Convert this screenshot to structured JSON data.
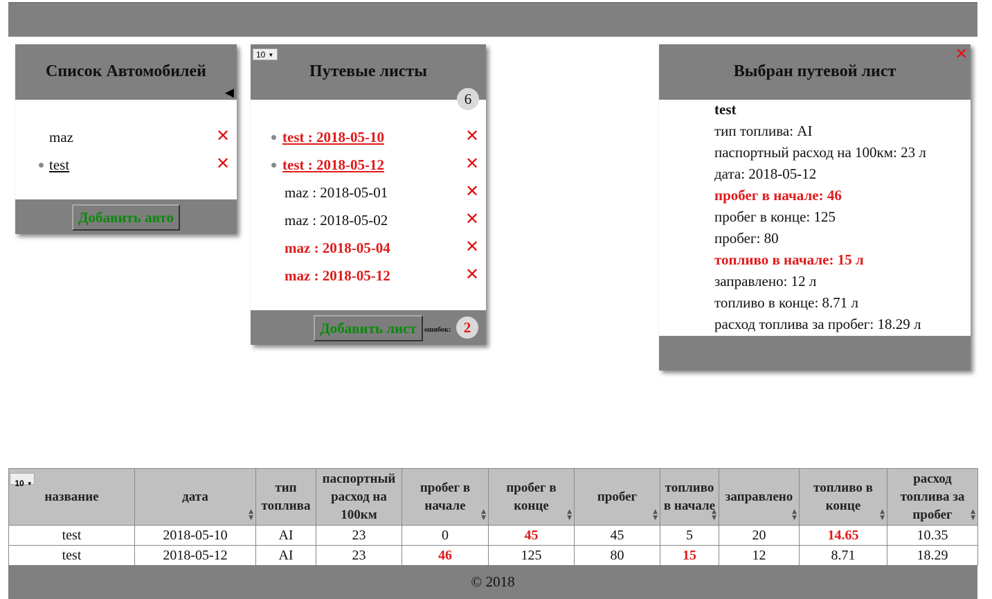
{
  "cars": {
    "title": "Список Автомобилей",
    "collapse_glyph": "◀",
    "items": [
      {
        "label": "maz"
      },
      {
        "label": "test"
      }
    ],
    "add_label": "Добавить авто"
  },
  "waybills": {
    "page_size": "10",
    "title": "Путевые листы",
    "count": "6",
    "items": [
      {
        "label": "test : 2018-05-10"
      },
      {
        "label": "test : 2018-05-12"
      },
      {
        "label": "maz : 2018-05-01"
      },
      {
        "label": "maz : 2018-05-02"
      },
      {
        "label": "maz : 2018-05-04"
      },
      {
        "label": "maz : 2018-05-12"
      }
    ],
    "add_label": "Добавить лист",
    "errors_label": "ошибок:",
    "errors_count": "2"
  },
  "selected": {
    "title": "Выбран путевой лист",
    "close_glyph": "✕",
    "name": "test",
    "fuel_type": "тип топлива: AI",
    "passport_rate": "паспортный расход на 100км: 23 л",
    "date": "дата: 2018-05-12",
    "mileage_start": "пробег в начале: 46",
    "mileage_end": "пробег в конце: 125",
    "mileage": "пробег: 80",
    "fuel_start": "топливо в начале: 15 л",
    "refueled": "заправлено: 12 л",
    "fuel_end": "топливо в конце: 8.71 л",
    "consumption": "расход топлива за пробег: 18.29 л"
  },
  "table": {
    "page_size": "10",
    "headers": [
      "название",
      "дата",
      "тип топлива",
      "паспортный расход на 100км",
      "пробег в начале",
      "пробег в конце",
      "пробег",
      "топливо в начале",
      "заправлено",
      "топливо в конце",
      "расход топлива за пробег"
    ],
    "rows": [
      [
        "test",
        "2018-05-10",
        "AI",
        "23",
        "0",
        "45",
        "45",
        "5",
        "20",
        "14.65",
        "10.35"
      ],
      [
        "test",
        "2018-05-12",
        "AI",
        "23",
        "46",
        "125",
        "80",
        "15",
        "12",
        "8.71",
        "18.29"
      ]
    ]
  },
  "footer": "© 2018",
  "colors": {
    "error": "#e01a1a",
    "button_text": "#0a8a0a",
    "panel_header": "#808080"
  }
}
